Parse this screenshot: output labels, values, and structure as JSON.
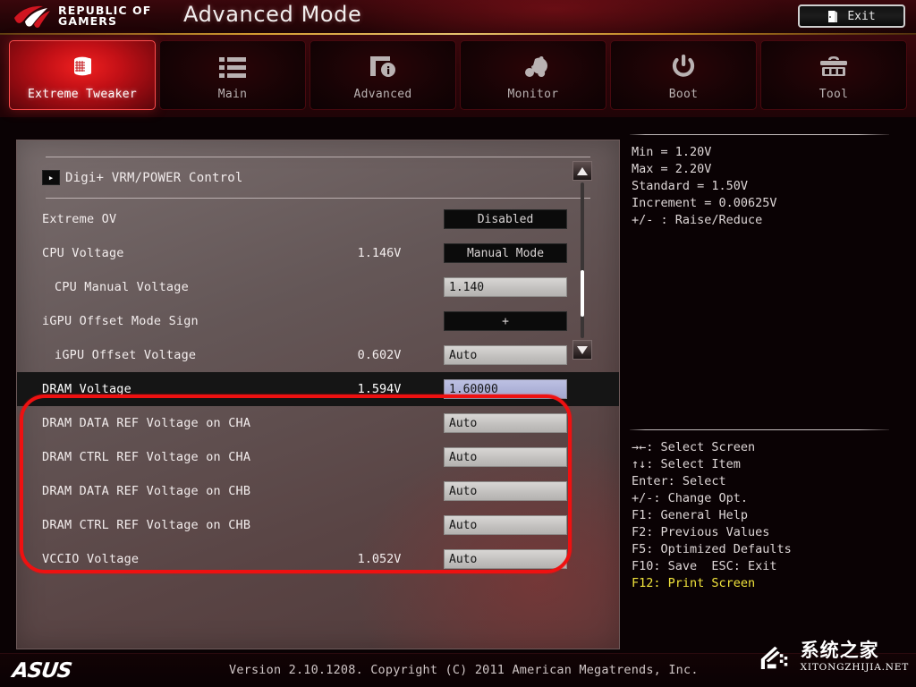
{
  "header": {
    "brand_line1": "REPUBLIC OF",
    "brand_line2": "GAMERS",
    "brand_icon": "rog-eye-logo",
    "title": "Advanced Mode",
    "exit_label": "Exit",
    "exit_icon": "door-exit-icon"
  },
  "tabs": [
    {
      "label": "Extreme Tweaker",
      "icon": "overclock-coil-icon",
      "active": true
    },
    {
      "label": "Main",
      "icon": "list-icon",
      "active": false
    },
    {
      "label": "Advanced",
      "icon": "monitor-info-icon",
      "active": false
    },
    {
      "label": "Monitor",
      "icon": "fan-thermometer-icon",
      "active": false
    },
    {
      "label": "Boot",
      "icon": "power-icon",
      "active": false
    },
    {
      "label": "Tool",
      "icon": "toolbox-icon",
      "active": false
    }
  ],
  "content": {
    "submenu": {
      "label": "Digi+ VRM/POWER Control",
      "icon": "chevron-right-icon"
    },
    "rows": [
      {
        "name": "Extreme OV",
        "measure": "",
        "value": "Disabled",
        "field_style": "dark",
        "indent": false,
        "highlight": false
      },
      {
        "name": "CPU Voltage",
        "measure": "1.146V",
        "value": "Manual Mode",
        "field_style": "dark",
        "indent": false,
        "highlight": false
      },
      {
        "name": "CPU Manual Voltage",
        "measure": "",
        "value": "1.140",
        "field_style": "light",
        "indent": true,
        "highlight": false
      },
      {
        "name": "iGPU Offset Mode Sign",
        "measure": "",
        "value": "+",
        "field_style": "dark",
        "indent": false,
        "highlight": false
      },
      {
        "name": "iGPU Offset Voltage",
        "measure": "0.602V",
        "value": "Auto",
        "field_style": "light",
        "indent": true,
        "highlight": false
      },
      {
        "name": "DRAM Voltage",
        "measure": "1.594V",
        "value": "1.60000",
        "field_style": "selected",
        "indent": false,
        "highlight": true
      },
      {
        "name": "DRAM DATA REF Voltage on CHA",
        "measure": "",
        "value": "Auto",
        "field_style": "light",
        "indent": false,
        "highlight": false
      },
      {
        "name": "DRAM CTRL REF Voltage on CHA",
        "measure": "",
        "value": "Auto",
        "field_style": "light",
        "indent": false,
        "highlight": false
      },
      {
        "name": "DRAM DATA REF Voltage on CHB",
        "measure": "",
        "value": "Auto",
        "field_style": "light",
        "indent": false,
        "highlight": false
      },
      {
        "name": "DRAM CTRL REF Voltage on CHB",
        "measure": "",
        "value": "Auto",
        "field_style": "light",
        "indent": false,
        "highlight": false
      },
      {
        "name": "VCCIO Voltage",
        "measure": "1.052V",
        "value": "Auto",
        "field_style": "light",
        "indent": false,
        "highlight": false
      }
    ],
    "scrollbar": {
      "up_icon": "triangle-up-icon",
      "down_icon": "triangle-down-icon"
    }
  },
  "help": {
    "lines": [
      "Min = 1.20V",
      "Max = 2.20V",
      "Standard = 1.50V",
      "Increment = 0.00625V",
      "+/- : Raise/Reduce"
    ]
  },
  "keys": {
    "lines": [
      {
        "text": "→←: Select Screen",
        "accent": false
      },
      {
        "text": "↑↓: Select Item",
        "accent": false
      },
      {
        "text": "Enter: Select",
        "accent": false
      },
      {
        "text": "+/-: Change Opt.",
        "accent": false
      },
      {
        "text": "F1: General Help",
        "accent": false
      },
      {
        "text": "F2: Previous Values",
        "accent": false
      },
      {
        "text": "F5: Optimized Defaults",
        "accent": false
      },
      {
        "text": "F10: Save  ESC: Exit",
        "accent": false
      },
      {
        "text": "F12: Print Screen",
        "accent": true
      }
    ]
  },
  "footer": {
    "asus_logo": "ASUS",
    "version": "Version 2.10.1208. Copyright (C) 2011 American Megatrends, Inc."
  },
  "watermark": {
    "glyph": "house-pixel-icon",
    "cn": "系统之家",
    "en": "XITONGZHIJIA.NET"
  },
  "annotation": {
    "shape": "rounded-rectangle",
    "color": "#ee1111"
  },
  "colors": {
    "accent_red": "#c21016",
    "gold_rule": "#e0a535",
    "selected_field": "#aeb2d8",
    "highlight_row": "#151515",
    "key_accent": "#f2e53c"
  }
}
